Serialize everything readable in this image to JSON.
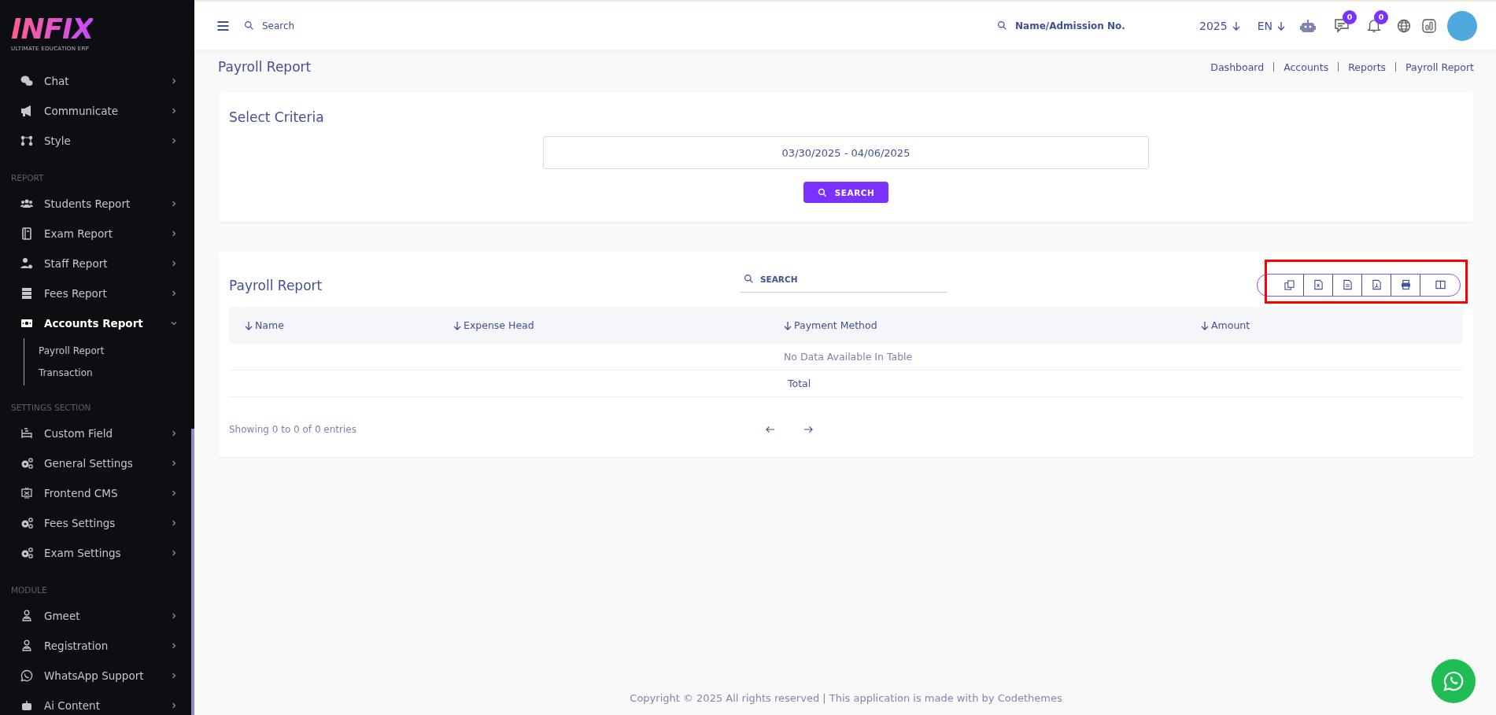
{
  "sidebar": {
    "logo": {
      "title": "INFIX",
      "subtitle": "ULTIMATE EDUCATION ERP"
    },
    "sections": [
      {
        "items": [
          {
            "label": "Chat",
            "expanded": false,
            "selected": false
          },
          {
            "label": "Communicate",
            "expanded": false,
            "selected": false
          },
          {
            "label": "Style",
            "expanded": false,
            "selected": false
          }
        ]
      },
      {
        "heading": "REPORT",
        "items": [
          {
            "label": "Students Report",
            "expanded": false,
            "selected": false
          },
          {
            "label": "Exam Report",
            "expanded": false,
            "selected": false
          },
          {
            "label": "Staff Report",
            "expanded": false,
            "selected": false
          },
          {
            "label": "Fees Report",
            "expanded": false,
            "selected": false
          },
          {
            "label": "Accounts Report",
            "expanded": true,
            "selected": true,
            "children": [
              {
                "label": "Payroll Report"
              },
              {
                "label": "Transaction"
              }
            ]
          }
        ]
      },
      {
        "heading": "SETTINGS SECTION",
        "items": [
          {
            "label": "Custom Field",
            "expanded": false,
            "selected": false
          },
          {
            "label": "General Settings",
            "expanded": false,
            "selected": false
          },
          {
            "label": "Frontend CMS",
            "expanded": false,
            "selected": false
          },
          {
            "label": "Fees Settings",
            "expanded": false,
            "selected": false
          },
          {
            "label": "Exam Settings",
            "expanded": false,
            "selected": false
          }
        ]
      },
      {
        "heading": "MODULE",
        "items": [
          {
            "label": "Gmeet",
            "expanded": false,
            "selected": false
          },
          {
            "label": "Registration",
            "expanded": false,
            "selected": false
          },
          {
            "label": "WhatsApp Support",
            "expanded": false,
            "selected": false
          },
          {
            "label": "Ai Content",
            "expanded": false,
            "selected": false
          }
        ]
      }
    ]
  },
  "header": {
    "search": {
      "placeholder": "Search"
    },
    "student_search": {
      "placeholder": "Name/Admission No."
    },
    "year": "2025",
    "language": "EN",
    "messages_badge": "0",
    "notifications_badge": "0"
  },
  "page": {
    "title": "Payroll Report",
    "breadcrumb": [
      "Dashboard",
      "Accounts",
      "Reports",
      "Payroll Report"
    ]
  },
  "criteria": {
    "title": "Select Criteria",
    "date_range": "03/30/2025 - 04/06/2025",
    "button": "SEARCH"
  },
  "report": {
    "title": "Payroll Report",
    "search": {
      "placeholder": "SEARCH"
    },
    "columns": [
      "Name",
      "Expense Head",
      "Payment Method",
      "Amount"
    ],
    "empty_message": "No Data Available In Table",
    "total_label": "Total",
    "info": "Showing 0 to 0 of 0 entries"
  },
  "footer": "Copyright © 2025 All rights reserved | This application is made with by Codethemes"
}
